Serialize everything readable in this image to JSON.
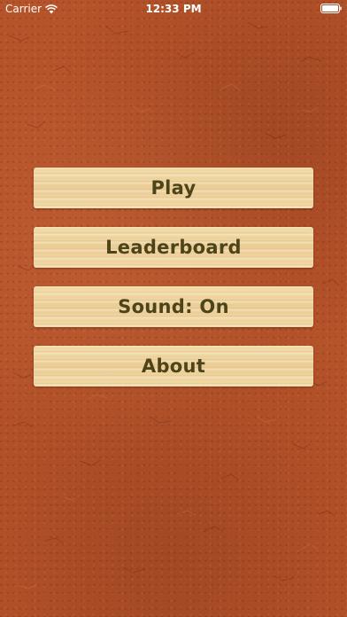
{
  "status_bar": {
    "carrier": "Carrier",
    "time": "12:33 PM",
    "wifi_icon": "wifi-icon",
    "battery_icon": "battery-icon"
  },
  "menu": {
    "items": [
      {
        "label": "Play"
      },
      {
        "label": "Leaderboard"
      },
      {
        "label": "Sound: On"
      },
      {
        "label": "About"
      }
    ]
  },
  "colors": {
    "background": "#b5532a",
    "button_wood": "#f0d8a4",
    "button_text": "#4d4419",
    "status_text": "#ffffff"
  }
}
